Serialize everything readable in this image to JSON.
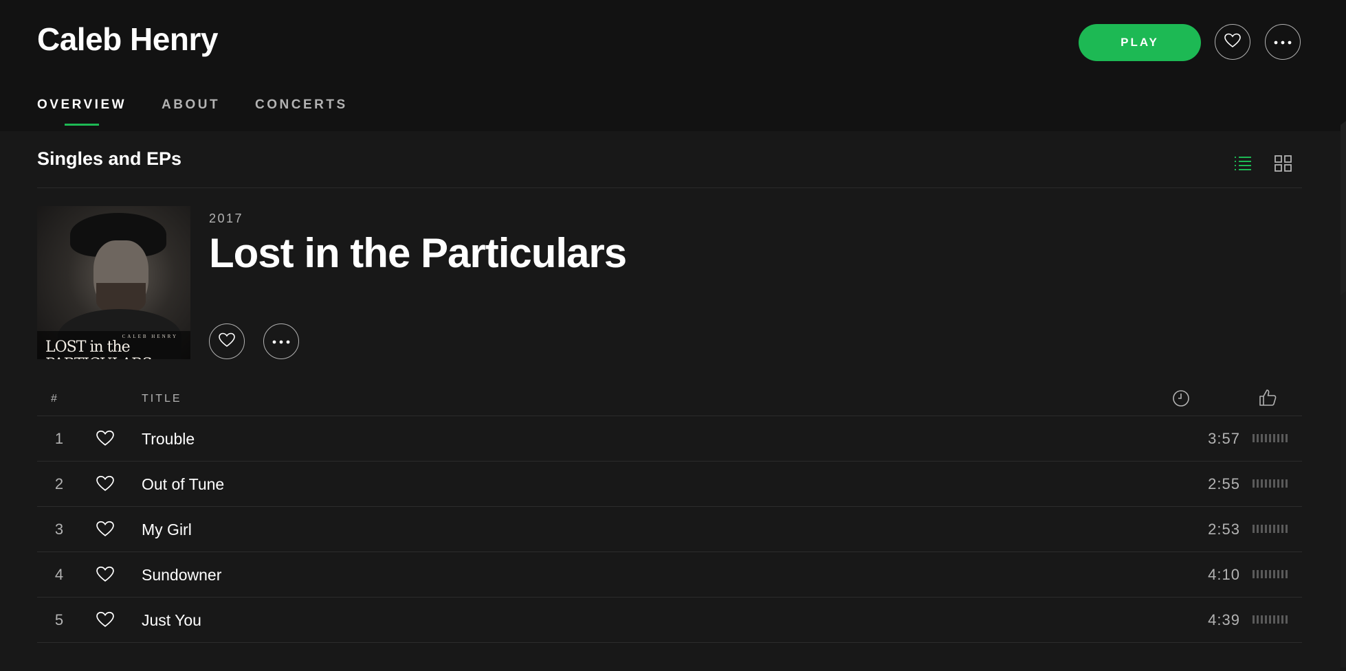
{
  "artist": {
    "name": "Caleb Henry"
  },
  "header_actions": {
    "play_label": "PLAY"
  },
  "tabs": [
    {
      "label": "OVERVIEW",
      "active": true
    },
    {
      "label": "ABOUT",
      "active": false
    },
    {
      "label": "CONCERTS",
      "active": false
    }
  ],
  "section": {
    "title": "Singles and EPs",
    "view_mode": "list"
  },
  "album": {
    "year": "2017",
    "title": "Lost in the Particulars",
    "cover_small_text": "CALEB HENRY",
    "cover_title_text": "LOST in the PARTICULARS"
  },
  "tracklist_header": {
    "number": "#",
    "title": "TITLE"
  },
  "tracks": [
    {
      "number": "1",
      "title": "Trouble",
      "duration": "3:57"
    },
    {
      "number": "2",
      "title": "Out of Tune",
      "duration": "2:55"
    },
    {
      "number": "3",
      "title": "My Girl",
      "duration": "2:53"
    },
    {
      "number": "4",
      "title": "Sundowner",
      "duration": "4:10"
    },
    {
      "number": "5",
      "title": "Just You",
      "duration": "4:39"
    }
  ],
  "colors": {
    "accent": "#1db954",
    "background": "#181818",
    "header_background": "#121212"
  }
}
